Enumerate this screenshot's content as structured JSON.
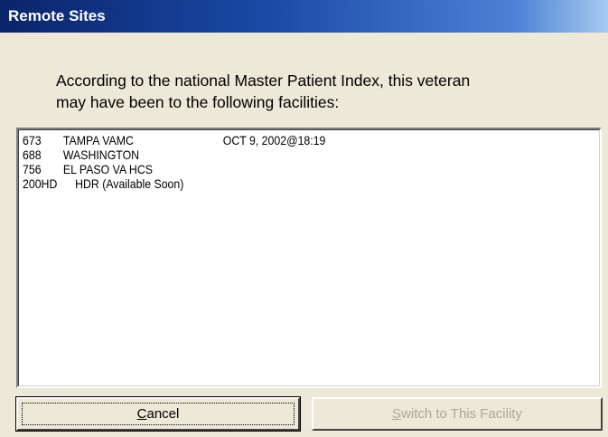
{
  "window": {
    "title": "Remote Sites"
  },
  "message": {
    "line1": "According to the national Master Patient Index, this veteran",
    "line2": "may have been to the following facilities:"
  },
  "facilities": [
    {
      "code": "673",
      "name": "TAMPA VAMC",
      "date": "OCT 9, 2002@18:19"
    },
    {
      "code": "688",
      "name": "WASHINGTON",
      "date": ""
    },
    {
      "code": "756",
      "name": "EL PASO VA HCS",
      "date": ""
    },
    {
      "code": "200HD",
      "name": "HDR (Available Soon)",
      "date": ""
    }
  ],
  "buttons": {
    "cancel": {
      "label_first": "C",
      "label_rest": "ancel",
      "enabled": true
    },
    "switch": {
      "label_first": "S",
      "label_rest": "witch to This Facility",
      "enabled": false
    }
  }
}
